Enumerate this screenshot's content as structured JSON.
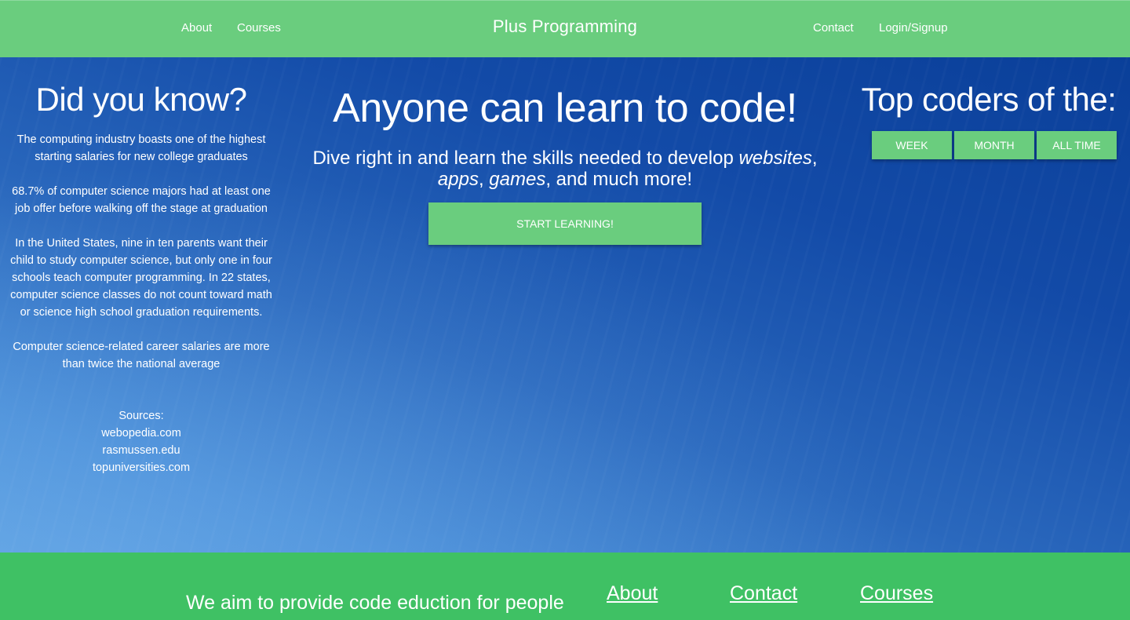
{
  "header": {
    "brand": "Plus Programming",
    "nav_left": [
      {
        "label": "About"
      },
      {
        "label": "Courses"
      }
    ],
    "nav_right": [
      {
        "label": "Contact"
      },
      {
        "label": "Login/Signup"
      }
    ]
  },
  "facts": {
    "title": "Did you know?",
    "items": [
      "The computing industry boasts one of the highest starting salaries for new college graduates",
      "68.7% of computer science majors had at least one job offer before walking off the stage at graduation",
      "In the United States, nine in ten parents want their child to study computer science, but only one in four schools teach computer programming. In 22 states, computer science classes do not count toward math or science high school graduation requirements.",
      "Computer science-related career salaries are more than twice the national average"
    ],
    "sources_label": "Sources:",
    "sources": [
      "webopedia.com",
      "rasmussen.edu",
      "topuniversities.com"
    ]
  },
  "hero": {
    "headline": "Anyone can learn to code!",
    "tagline_start": "Dive right in and learn the skills needed to develop ",
    "tagline_websites": "websites",
    "tagline_sep1": ", ",
    "tagline_apps": "apps",
    "tagline_sep2": ", ",
    "tagline_games": "games",
    "tagline_end": ", and much more!",
    "start_button": "START LEARNING!"
  },
  "leaderboard": {
    "title": "Top coders of the:",
    "periods": [
      {
        "label": "WEEK"
      },
      {
        "label": "MONTH"
      },
      {
        "label": "ALL TIME"
      }
    ]
  },
  "footer": {
    "text": "We aim to provide code eduction for people",
    "links": [
      {
        "label": "About"
      },
      {
        "label": "Contact"
      },
      {
        "label": "Courses"
      }
    ]
  },
  "colors": {
    "primary_green": "#6acd7e",
    "footer_green": "#3fc164",
    "hero_blue_dark": "#0a3f99",
    "hero_blue_light": "#5b9fe0"
  }
}
